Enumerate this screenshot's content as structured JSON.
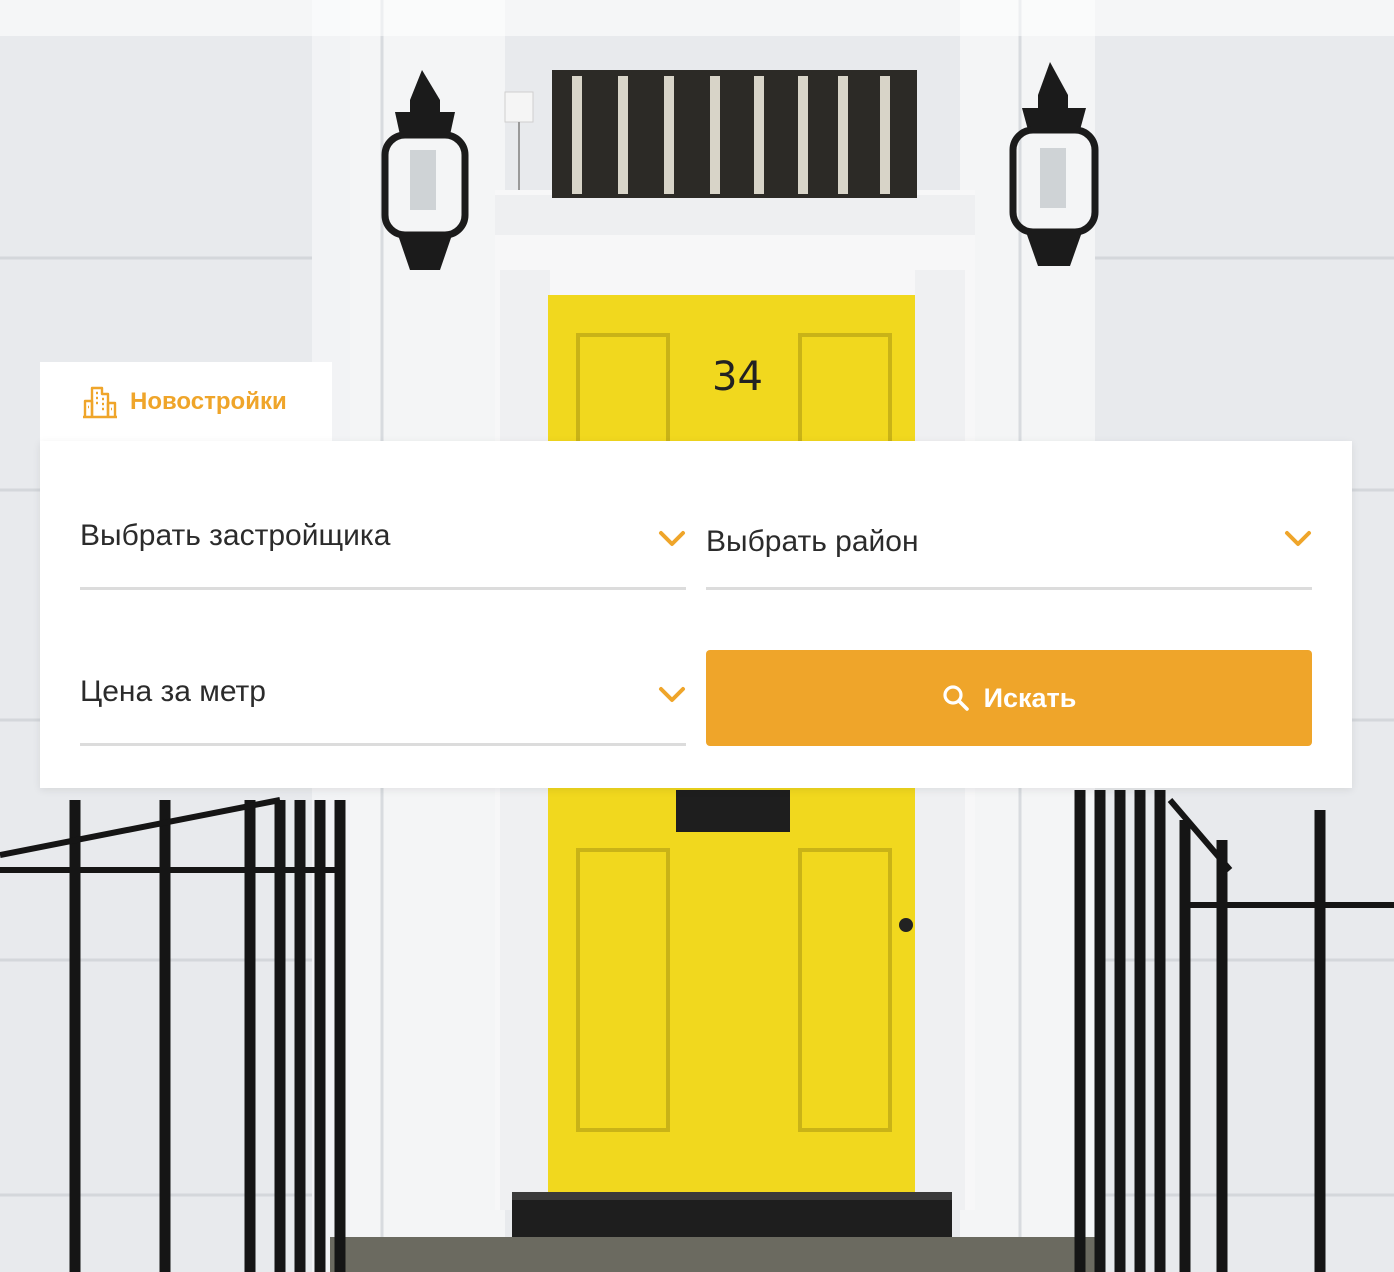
{
  "colors": {
    "accent": "#efa52a",
    "panel_bg": "#ffffff",
    "text": "#2b2b2b",
    "underline": "#dcdcdc",
    "door": "#f1d81e"
  },
  "background": {
    "door_number": "34"
  },
  "tabs": [
    {
      "label": "Новостройки",
      "icon": "building-icon",
      "active": true
    }
  ],
  "form": {
    "developer": {
      "label": "Выбрать застройщика",
      "icon": "chevron-down-icon"
    },
    "district": {
      "label": "Выбрать район",
      "icon": "chevron-down-icon"
    },
    "price": {
      "label": "Цена за метр",
      "icon": "chevron-down-icon"
    },
    "search_button": {
      "label": "Искать",
      "icon": "search-icon"
    }
  }
}
